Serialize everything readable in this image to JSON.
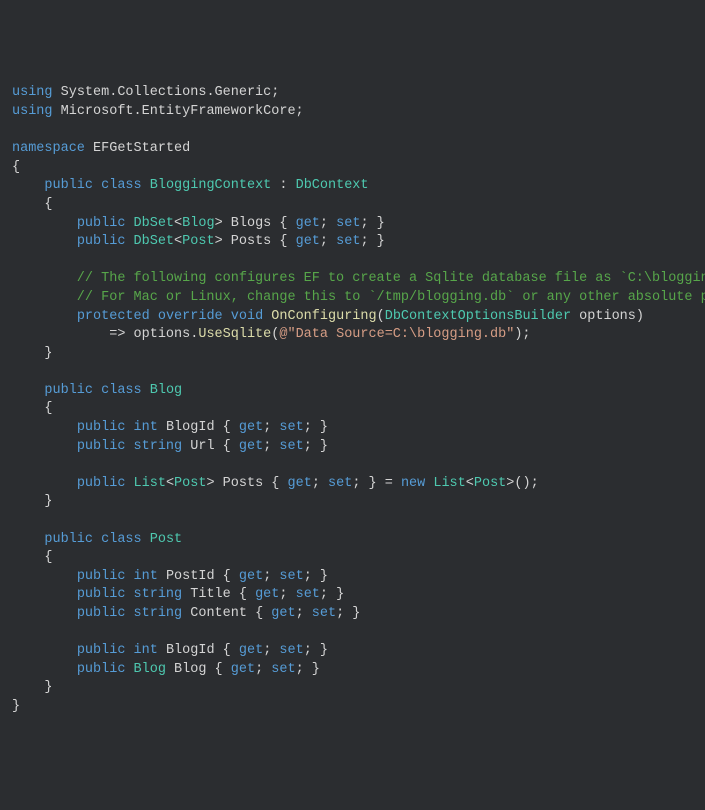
{
  "code": {
    "line1": {
      "kw1": "using",
      "ns1": " System.Collections.Generic;"
    },
    "line2": {
      "kw1": "using",
      "ns1": " Microsoft.EntityFrameworkCore;"
    },
    "line3": "",
    "line4": {
      "kw1": "namespace",
      "ns1": " EFGetStarted"
    },
    "line5": "{",
    "line6": {
      "pad": "    ",
      "kw1": "public",
      "sp1": " ",
      "kw2": "class",
      "sp2": " ",
      "type1": "BloggingContext",
      "col": " : ",
      "type2": "DbContext"
    },
    "line7": "    {",
    "line8": {
      "pad": "        ",
      "kw1": "public",
      "sp1": " ",
      "type1": "DbSet",
      "lt": "<",
      "type2": "Blog",
      "gt": ">",
      "sp2": " ",
      "ident": "Blogs",
      "ob": " { ",
      "kw2": "get",
      "sc1": "; ",
      "kw3": "set",
      "sc2": "; }"
    },
    "line9": {
      "pad": "        ",
      "kw1": "public",
      "sp1": " ",
      "type1": "DbSet",
      "lt": "<",
      "type2": "Post",
      "gt": ">",
      "sp2": " ",
      "ident": "Posts",
      "ob": " { ",
      "kw2": "get",
      "sc1": "; ",
      "kw3": "set",
      "sc2": "; }"
    },
    "line10": "",
    "line11": "        // The following configures EF to create a Sqlite database file as `C:\\blogging.db",
    "line12": "        // For Mac or Linux, change this to `/tmp/blogging.db` or any other absolute path.",
    "line13": {
      "pad": "        ",
      "kw1": "protected",
      "sp1": " ",
      "kw2": "override",
      "sp2": " ",
      "kw3": "void",
      "sp3": " ",
      "method": "OnConfiguring",
      "op": "(",
      "type1": "DbContextOptionsBuilder",
      "sp4": " ",
      "ident": "options)"
    },
    "line14": {
      "pad": "            => ",
      "ident1": "options.",
      "method": "UseSqlite",
      "op": "(",
      "at": "@",
      "str": "\"Data Source=C:\\blogging.db\"",
      "cp": ");"
    },
    "line15": "    }",
    "line16": "",
    "line17": {
      "pad": "    ",
      "kw1": "public",
      "sp1": " ",
      "kw2": "class",
      "sp2": " ",
      "type1": "Blog"
    },
    "line18": "    {",
    "line19": {
      "pad": "        ",
      "kw1": "public",
      "sp1": " ",
      "kw2": "int",
      "sp2": " ",
      "ident": "BlogId",
      "ob": " { ",
      "kw3": "get",
      "sc1": "; ",
      "kw4": "set",
      "sc2": "; }"
    },
    "line20": {
      "pad": "        ",
      "kw1": "public",
      "sp1": " ",
      "kw2": "string",
      "sp2": " ",
      "ident": "Url",
      "ob": " { ",
      "kw3": "get",
      "sc1": "; ",
      "kw4": "set",
      "sc2": "; }"
    },
    "line21": "",
    "line22": {
      "pad": "        ",
      "kw1": "public",
      "sp1": " ",
      "type1": "List",
      "lt": "<",
      "type2": "Post",
      "gt": ">",
      "sp2": " ",
      "ident": "Posts",
      "ob": " { ",
      "kw2": "get",
      "sc1": "; ",
      "kw3": "set",
      "sc2": "; } = ",
      "kw4": "new",
      "sp3": " ",
      "type3": "List",
      "lt2": "<",
      "type4": "Post",
      "gt2": ">",
      "ctor": "();"
    },
    "line23": "    }",
    "line24": "",
    "line25": {
      "pad": "    ",
      "kw1": "public",
      "sp1": " ",
      "kw2": "class",
      "sp2": " ",
      "type1": "Post"
    },
    "line26": "    {",
    "line27": {
      "pad": "        ",
      "kw1": "public",
      "sp1": " ",
      "kw2": "int",
      "sp2": " ",
      "ident": "PostId",
      "ob": " { ",
      "kw3": "get",
      "sc1": "; ",
      "kw4": "set",
      "sc2": "; }"
    },
    "line28": {
      "pad": "        ",
      "kw1": "public",
      "sp1": " ",
      "kw2": "string",
      "sp2": " ",
      "ident": "Title",
      "ob": " { ",
      "kw3": "get",
      "sc1": "; ",
      "kw4": "set",
      "sc2": "; }"
    },
    "line29": {
      "pad": "        ",
      "kw1": "public",
      "sp1": " ",
      "kw2": "string",
      "sp2": " ",
      "ident": "Content",
      "ob": " { ",
      "kw3": "get",
      "sc1": "; ",
      "kw4": "set",
      "sc2": "; }"
    },
    "line30": "",
    "line31": {
      "pad": "        ",
      "kw1": "public",
      "sp1": " ",
      "kw2": "int",
      "sp2": " ",
      "ident": "BlogId",
      "ob": " { ",
      "kw3": "get",
      "sc1": "; ",
      "kw4": "set",
      "sc2": "; }"
    },
    "line32": {
      "pad": "        ",
      "kw1": "public",
      "sp1": " ",
      "type1": "Blog",
      "sp2": " ",
      "ident": "Blog",
      "ob": " { ",
      "kw2": "get",
      "sc1": "; ",
      "kw3": "set",
      "sc2": "; }"
    },
    "line33": "    }",
    "line34": "}"
  }
}
